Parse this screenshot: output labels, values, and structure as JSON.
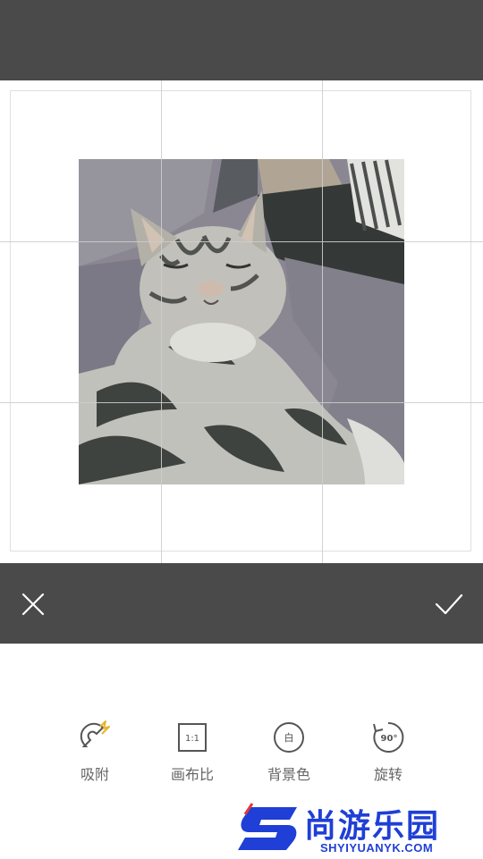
{
  "editor": {
    "cancel_icon": "close-icon",
    "confirm_icon": "check-icon"
  },
  "tools": [
    {
      "id": "snap",
      "label": "吸附",
      "icon": "magnet-icon",
      "glyph": ""
    },
    {
      "id": "ratio",
      "label": "画布比",
      "icon": "aspect-ratio-icon",
      "glyph": "1:1"
    },
    {
      "id": "bg",
      "label": "背景色",
      "icon": "background-color-icon",
      "glyph": "白"
    },
    {
      "id": "rotate",
      "label": "旋转",
      "icon": "rotate-icon",
      "glyph": "90°"
    }
  ],
  "watermark": {
    "title": "尚游乐园",
    "url": "SHYIYUANYK.COM"
  },
  "colors": {
    "bar": "#4a4a4a",
    "tool_text": "#666666",
    "watermark": "#1f3fd6"
  }
}
